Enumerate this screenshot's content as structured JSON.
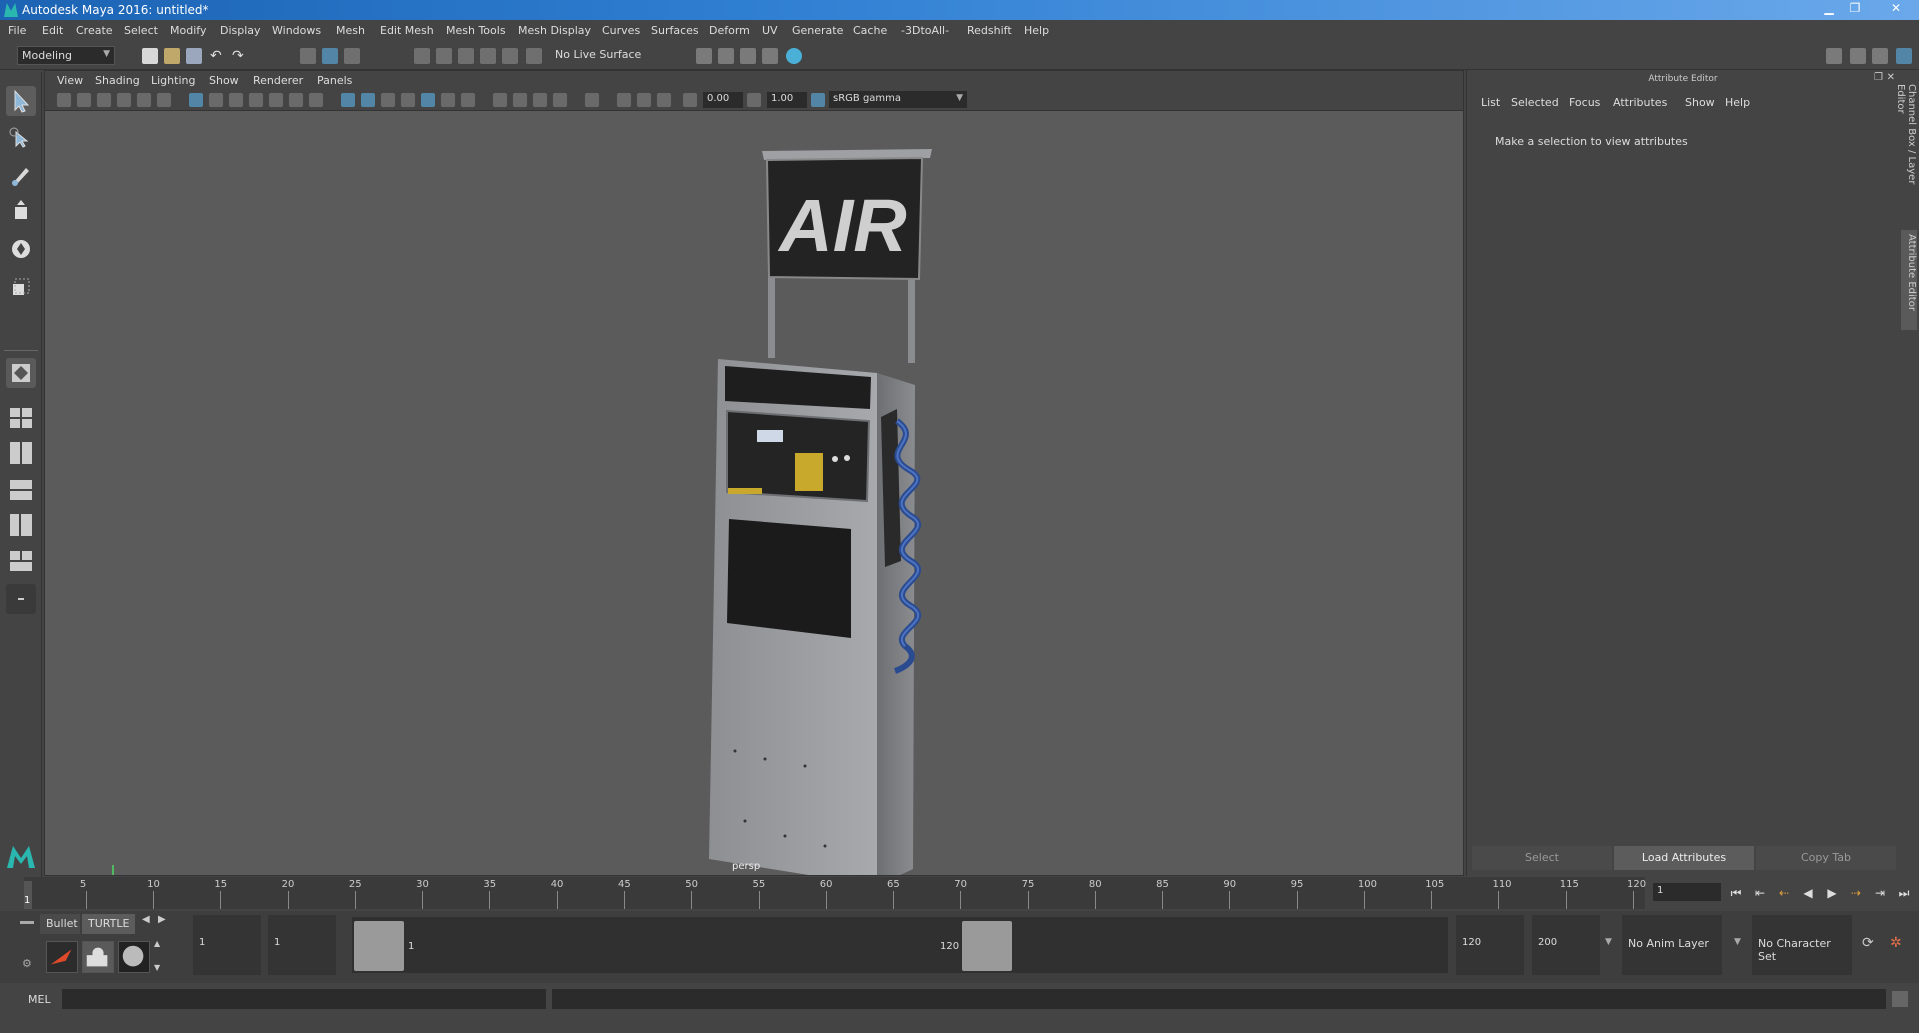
{
  "window": {
    "title": "Autodesk Maya 2016: untitled*",
    "minimize": "▁",
    "restore": "❐",
    "close": "✕"
  },
  "menubar": {
    "items": [
      "File",
      "Edit",
      "Create",
      "Select",
      "Modify",
      "Display",
      "Windows",
      "Mesh",
      "Edit Mesh",
      "Mesh Tools",
      "Mesh Display",
      "Curves",
      "Surfaces",
      "Deform",
      "UV",
      "Generate",
      "Cache",
      "-3DtoAll-",
      "Redshift",
      "Help"
    ]
  },
  "statusline": {
    "mode": "Modeling",
    "live_surface": "No Live Surface"
  },
  "panel": {
    "menu": [
      "View",
      "Shading",
      "Lighting",
      "Show",
      "Renderer",
      "Panels"
    ],
    "exposure": "0.00",
    "gamma": "1.00",
    "color_space": "sRGB gamma",
    "camera": "persp"
  },
  "scene": {
    "sign_text": "AIR"
  },
  "attribute_editor": {
    "title": "Attribute Editor",
    "menu": [
      "List",
      "Selected",
      "Focus",
      "Attributes",
      "Show",
      "Help"
    ],
    "hint": "Make a selection to view attributes",
    "buttons": {
      "select": "Select",
      "load": "Load Attributes",
      "copy": "Copy Tab"
    }
  },
  "side_tabs": {
    "channel_box": "Channel Box / Layer Editor",
    "attribute_editor": "Attribute Editor"
  },
  "timeslider": {
    "ticks": [
      "5",
      "10",
      "15",
      "20",
      "25",
      "30",
      "35",
      "40",
      "45",
      "50",
      "55",
      "60",
      "65",
      "70",
      "75",
      "80",
      "85",
      "90",
      "95",
      "100",
      "105",
      "110",
      "115",
      "120"
    ],
    "current_frame_marker": "1",
    "current_frame": "1"
  },
  "range": {
    "shelf_tabs": [
      "Bullet",
      "TURTLE"
    ],
    "start_frame": "1",
    "playback_start": "1",
    "range_start_label": "1",
    "range_end_label": "120",
    "playback_end": "120",
    "end_frame": "200",
    "anim_layer": "No Anim Layer",
    "character_set": "No Character Set"
  },
  "cmdline": {
    "language": "MEL"
  },
  "colors": {
    "accent": "#5285a6",
    "titlebar": "#1c63b3",
    "maya_teal": "#2ab7b0"
  }
}
